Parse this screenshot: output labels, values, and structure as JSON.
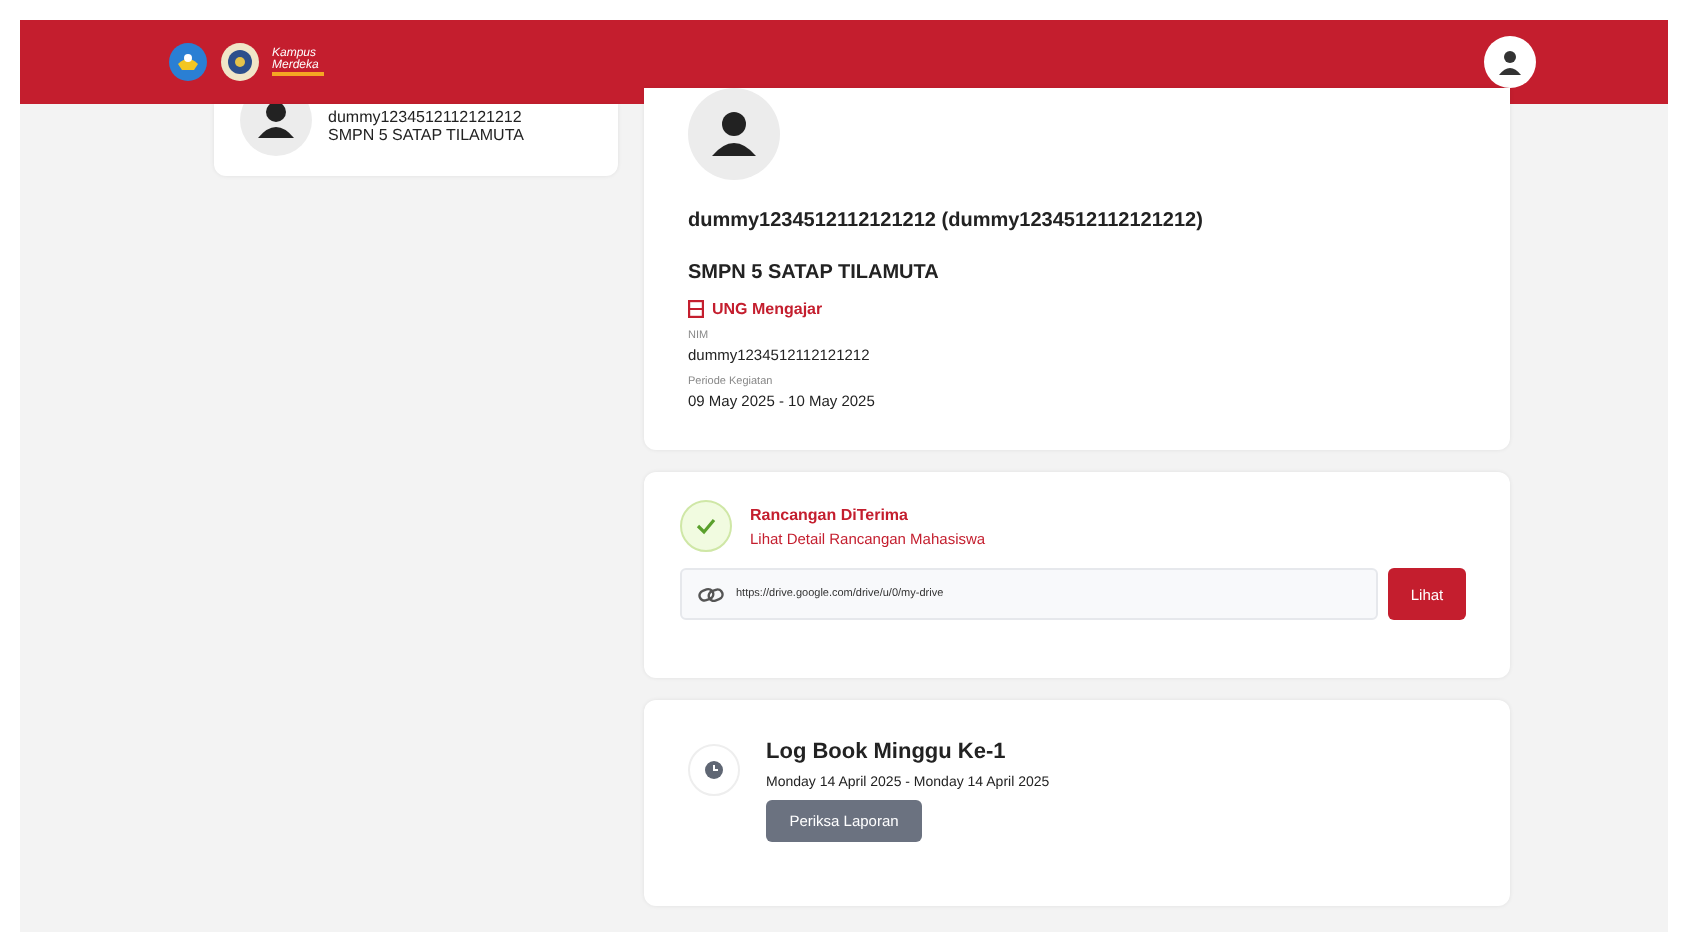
{
  "header": {
    "brand": "Kampus Merdeka"
  },
  "profile_card": {
    "id": "dummy1234512112121212",
    "school": "SMPN 5 SATAP TILAMUTA"
  },
  "detail_card": {
    "name": "dummy1234512112121212 (dummy1234512112121212)",
    "school": "SMPN 5 SATAP TILAMUTA",
    "program": "UNG Mengajar",
    "fields": [
      {
        "label": "NIM",
        "value": "dummy1234512112121212"
      },
      {
        "label": "Periode Kegiatan",
        "value": "09 May 2025 - 10 May 2025"
      }
    ]
  },
  "plan_card": {
    "status": "Rancangan DiTerima",
    "link": "Lihat Detail Rancangan Mahasiswa",
    "url": "https://drive.google.com/drive/u/0/my-drive",
    "button": "Lihat"
  },
  "logbook_card": {
    "title": "Log Book Minggu Ke-1",
    "dates": "Monday 14 April 2025 - Monday 14 April 2025",
    "button": "Periksa Laporan"
  }
}
